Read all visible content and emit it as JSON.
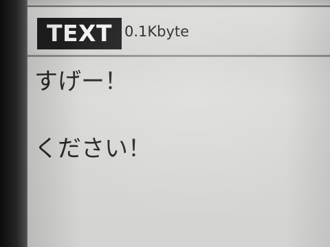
{
  "header": {
    "type_label": "TEXT",
    "size_label": "0.1Kbyte"
  },
  "content": {
    "lines": [
      "すげー！",
      "ください！"
    ]
  },
  "colors": {
    "badge_background": "#1e1e1e",
    "badge_text": "#f2f2f2",
    "screen_background": "#d6d6d4",
    "text": "#262626"
  }
}
